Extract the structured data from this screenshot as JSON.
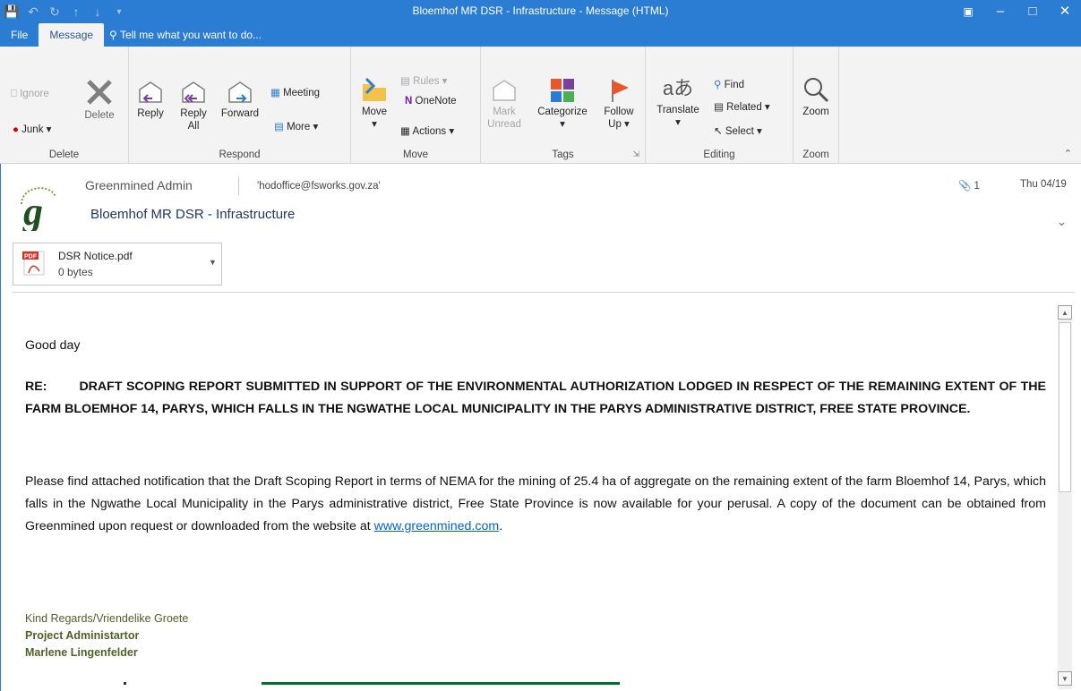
{
  "window": {
    "title": "Bloemhof MR DSR - Infrastructure - Message (HTML)"
  },
  "tabs": [
    "File",
    "Message"
  ],
  "tell_me": "Tell me what you want to do...",
  "ribbon": {
    "delete": {
      "ignore": "Ignore",
      "junk": "Junk",
      "delete": "Delete",
      "label": "Delete"
    },
    "respond": {
      "reply": "Reply",
      "reply_all_1": "Reply",
      "reply_all_2": "All",
      "forward": "Forward",
      "meeting": "Meeting",
      "more": "More",
      "label": "Respond"
    },
    "move": {
      "move": "Move",
      "rules": "Rules",
      "onenote": "OneNote",
      "actions": "Actions",
      "label": "Move"
    },
    "tags": {
      "mark_1": "Mark",
      "mark_2": "Unread",
      "categorize": "Categorize",
      "follow_1": "Follow",
      "follow_2": "Up",
      "label": "Tags"
    },
    "editing": {
      "translate": "Translate",
      "find": "Find",
      "related": "Related",
      "select": "Select",
      "label": "Editing"
    },
    "zoom": {
      "zoom": "Zoom",
      "label": "Zoom"
    }
  },
  "message": {
    "from": "Greenmined Admin",
    "to": "'hodoffice@fsworks.gov.za'",
    "subject": "Bloemhof MR DSR - Infrastructure",
    "attachment_count": "1",
    "date": "Thu 04/19"
  },
  "attachment": {
    "name": "DSR Notice.pdf",
    "size": "0 bytes"
  },
  "body": {
    "greeting": "Good day",
    "re_prefix": "RE:",
    "re_text": "DRAFT SCOPING REPORT SUBMITTED IN SUPPORT OF THE ENVIRONMENTAL AUTHORIZATION LODGED IN RESPECT OF THE REMAINING EXTENT OF THE FARM BLOEMHOF 14, PARYS, WHICH FALLS IN THE NGWATHE LOCAL MUNICIPALITY IN THE PARYS ADMINISTRATIVE DISTRICT, FREE STATE PROVINCE.",
    "main": "Please find attached notification that the Draft Scoping Report in terms of NEMA for the mining of 25.4 ha of aggregate on the remaining extent of the farm Bloemhof 14, Parys, which falls in the Ngwathe Local Municipality in the Parys administrative district, Free State Province is now available for your perusal. A copy of the document can be obtained from Greenmined upon request or downloaded from the website at ",
    "link": "www.greenmined.com",
    "end": "."
  },
  "signature": {
    "regards": "Kind Regards/Vriendelike Groete",
    "role": "Project Administartor",
    "name": "Marlene Lingenfelder"
  },
  "colors": {
    "accent": "#2b7cd3",
    "link": "#0563c1",
    "signature": "#4f6228"
  }
}
